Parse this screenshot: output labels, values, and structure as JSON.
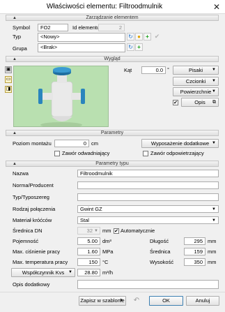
{
  "window": {
    "title": "Właściwości elementu: Filtroodmulnik",
    "close": "✕"
  },
  "identity": {
    "section": "Zarządzanie elementem",
    "symbol_label": "Symbol",
    "symbol_value": "FO2",
    "id_label": "Id elementu",
    "id_value": "2",
    "type_label": "Typ",
    "type_value": "<Nowy>",
    "group_label": "Grupa",
    "group_value": "<Brak>"
  },
  "look": {
    "section": "Wygląd",
    "angle_label": "Kąt",
    "angle_value": "0.0",
    "angle_unit": "°",
    "pens": "Pisaki",
    "fonts": "Czcionki",
    "surfaces": "Powierzchnie",
    "description": "Opis"
  },
  "params": {
    "section": "Parametry",
    "mount_label": "Poziom montażu",
    "mount_value": "0",
    "mount_unit": "cm",
    "extras": "Wyposażenie dodatkowe",
    "drain_valve": "Zawór odwadniający",
    "air_valve": "Zawór odpowietrzający"
  },
  "type_params": {
    "section": "Parametry typu",
    "name_label": "Nazwa",
    "name_value": "Filtroodmulnik",
    "manufacturer_label": "Norma/Producent",
    "manufacturer_value": "",
    "series_label": "Typ/Typoszereg",
    "series_value": "",
    "connection_label": "Rodzaj połączenia",
    "connection_value": "Gwint GZ",
    "material_label": "Materiał króćców",
    "material_value": "Stal",
    "dn_label": "Średnica DN",
    "dn_value": "32",
    "dn_unit": "mm",
    "auto_label": "Automatycznie",
    "volume_label": "Pojemność",
    "volume_value": "5.00",
    "volume_unit": "dm³",
    "pressure_label": "Max. ciśnienie pracy",
    "pressure_value": "1.60",
    "pressure_unit": "MPa",
    "temp_label": "Max. temperatura pracy",
    "temp_value": "150",
    "temp_unit": "°C",
    "kvs_label": "Współczynnik Kvs",
    "kvs_value": "28.80",
    "kvs_unit": "m³/h",
    "length_label": "Długość",
    "length_value": "295",
    "length_unit": "mm",
    "diameter_label": "Średnica",
    "diameter_value": "159",
    "diameter_unit": "mm",
    "height_label": "Wysokość",
    "height_value": "350",
    "height_unit": "mm",
    "extra_desc_label": "Opis dodatkowy",
    "extra_desc_value": ""
  },
  "footer": {
    "save_template": "Zapisz w szablonie",
    "ok": "OK",
    "cancel": "Anuluj"
  }
}
